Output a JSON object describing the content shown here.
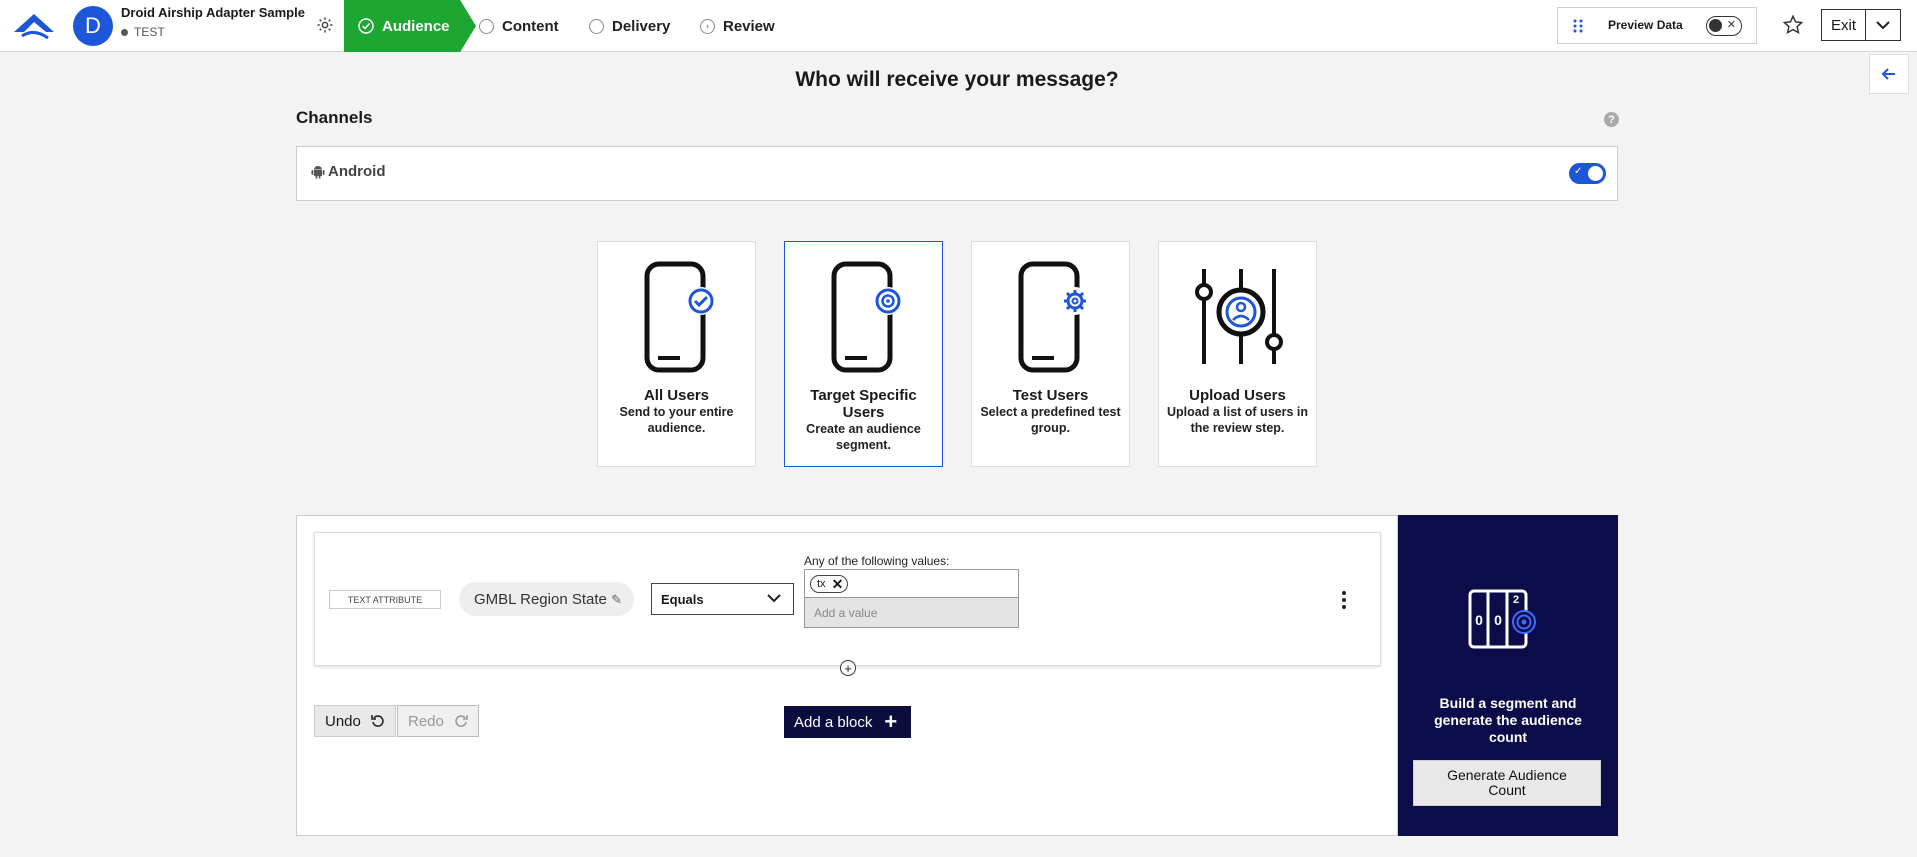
{
  "header": {
    "avatar_letter": "D",
    "app_name": "Droid Airship Adapter Sample",
    "environment": "TEST",
    "steps": [
      {
        "label": "Audience",
        "state": "active"
      },
      {
        "label": "Content",
        "state": "todo"
      },
      {
        "label": "Delivery",
        "state": "todo"
      },
      {
        "label": "Review",
        "state": "todo"
      }
    ],
    "preview_label": "Preview Data",
    "preview_enabled": false,
    "exit_label": "Exit"
  },
  "main": {
    "title": "Who will receive your message?",
    "channels_title": "Channels",
    "channels": [
      {
        "label": "Android",
        "enabled": true
      }
    ],
    "audience_options": [
      {
        "title": "All Users",
        "description": "Send to your entire audience.",
        "icon": "phone-check-icon",
        "selected": false
      },
      {
        "title": "Target Specific Users",
        "description": "Create an audience segment.",
        "icon": "phone-target-icon",
        "selected": true
      },
      {
        "title": "Test Users",
        "description": "Select a predefined test group.",
        "icon": "phone-gear-icon",
        "selected": false
      },
      {
        "title": "Upload Users",
        "description": "Upload a list of users in the review step.",
        "icon": "sliders-user-icon",
        "selected": false
      }
    ]
  },
  "segment": {
    "attribute_type": "TEXT ATTRIBUTE",
    "attribute_name": "GMBL Region State",
    "operator": "Equals",
    "values_label": "Any of the following values:",
    "values": [
      "tx"
    ],
    "add_value_placeholder": "Add a value",
    "undo_label": "Undo",
    "redo_label": "Redo",
    "add_block_label": "Add a block"
  },
  "generate": {
    "counter_digits": [
      "0",
      "0",
      "2"
    ],
    "text": "Build a segment and generate the audience count",
    "button_label": "Generate Audience Count"
  },
  "colors": {
    "brand_blue": "#1d56d8",
    "active_step_green": "#1ea632",
    "navy": "#0c0c4a"
  }
}
